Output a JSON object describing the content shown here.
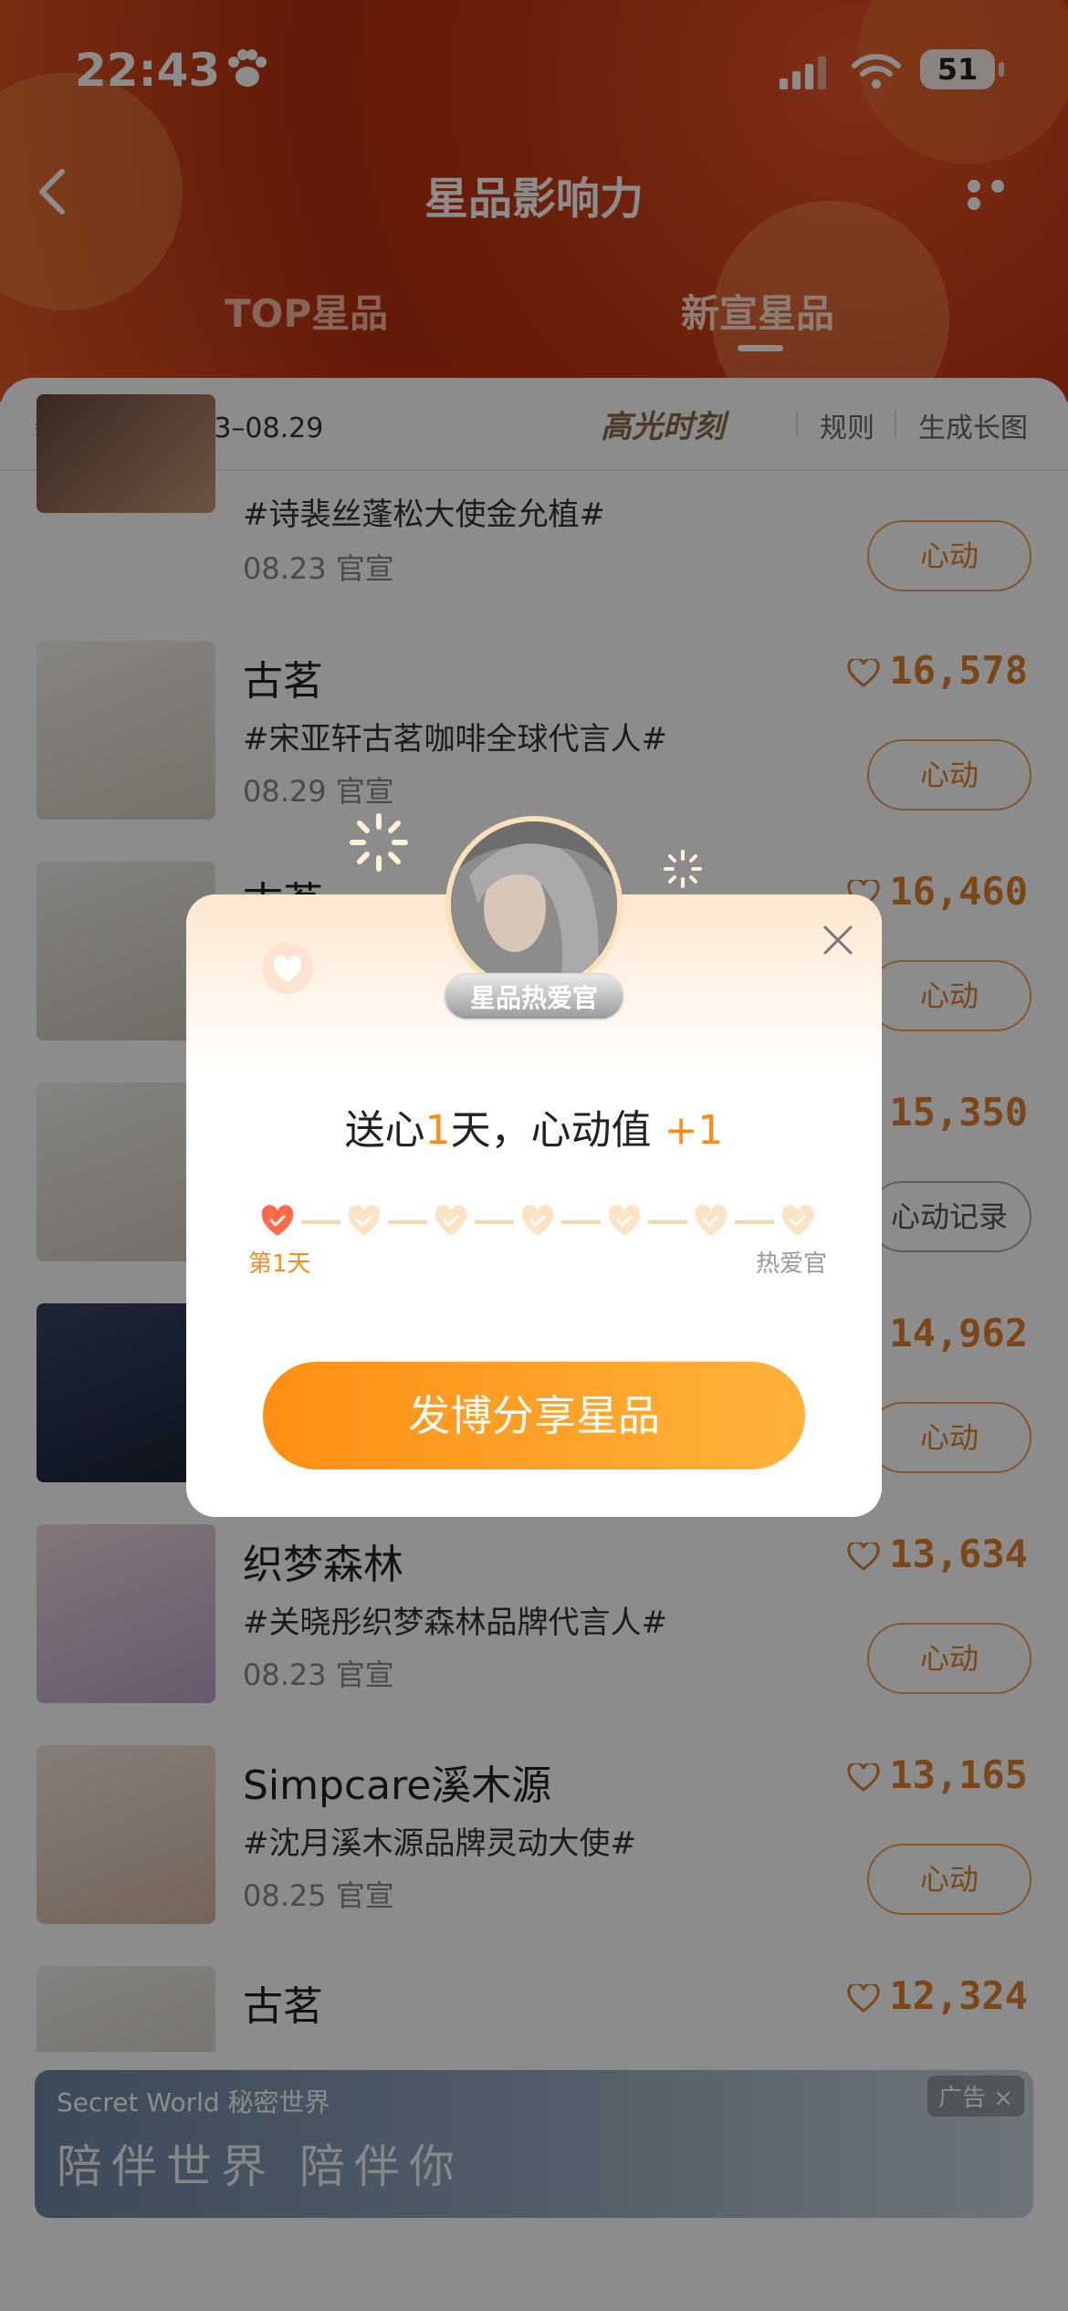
{
  "status_bar": {
    "time": "22:43",
    "battery": "51"
  },
  "nav": {
    "title": "星品影响力"
  },
  "tabs": [
    {
      "label": "TOP星品"
    },
    {
      "label": "新宣星品"
    }
  ],
  "subbar": {
    "period": "新宣周期 08.23–08.29",
    "highlight": "高光时刻",
    "rules": "规则",
    "long_image": "生成长图"
  },
  "list": [
    {
      "brand": "",
      "tag": "#诗裴丝蓬松大使金允植#",
      "date": "08.23 官宣",
      "score": "",
      "button": "心动"
    },
    {
      "brand": "古茗",
      "tag": "#宋亚轩古茗咖啡全球代言人#",
      "date": "08.29 官宣",
      "score": "16,578",
      "button": "心动"
    },
    {
      "brand": "古茗",
      "tag": "",
      "date": "",
      "score": "16,460",
      "button": "心动"
    },
    {
      "brand": "",
      "tag": "",
      "date": "",
      "score": "15,350",
      "button": "心动记录"
    },
    {
      "brand": "",
      "tag": "",
      "date": "",
      "score": "14,962",
      "button": "心动"
    },
    {
      "brand": "织梦森林",
      "tag": "#关晓彤织梦森林品牌代言人#",
      "date": "08.23 官宣",
      "score": "13,634",
      "button": "心动"
    },
    {
      "brand": "Simpcare溪木源",
      "tag": "#沈月溪木源品牌灵动大使#",
      "date": "08.25 官宣",
      "score": "13,165",
      "button": "心动"
    },
    {
      "brand": "古茗",
      "tag": "",
      "date": "",
      "score": "12,324",
      "button": ""
    }
  ],
  "ad": {
    "brand": "Secret World 秘密世界",
    "slogan": "陪伴世界 陪伴你",
    "label": "广告 ×"
  },
  "modal": {
    "badge": "星品热爱官",
    "headline_a": "送心",
    "headline_num": "1",
    "headline_b": "天，心动值",
    "headline_plus": "+1",
    "progress_days_total": 7,
    "progress_current": 1,
    "start_label": "第1天",
    "end_label": "热爱官",
    "cta": "发博分享星品"
  },
  "colors": {
    "accent": "#ff8a1a",
    "header": "#c53a12",
    "score": "#e2822a"
  }
}
